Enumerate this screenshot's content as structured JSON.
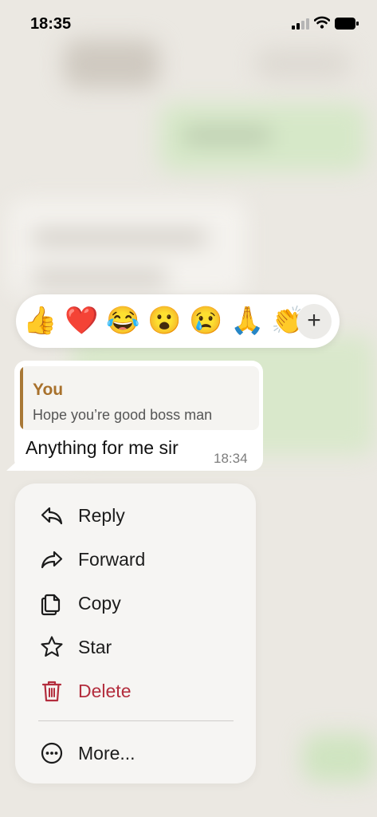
{
  "status_bar": {
    "time": "18:35"
  },
  "reactions": {
    "emojis": [
      "👍",
      "❤️",
      "😂",
      "😮",
      "😢",
      "🙏",
      "👏"
    ],
    "more_label": "+"
  },
  "message": {
    "quoted_author": "You",
    "quoted_text": "Hope you’re good boss man",
    "text": "Anything for me  sir",
    "time": "18:34"
  },
  "menu": {
    "items": [
      {
        "label": "Reply",
        "icon": "reply-icon"
      },
      {
        "label": "Forward",
        "icon": "forward-icon"
      },
      {
        "label": "Copy",
        "icon": "copy-icon"
      },
      {
        "label": "Star",
        "icon": "star-icon"
      },
      {
        "label": "Delete",
        "icon": "trash-icon"
      },
      {
        "label": "More...",
        "icon": "more-icon"
      }
    ]
  },
  "colors": {
    "quote_accent": "#a8712c",
    "delete": "#b32d3d",
    "menu_bg": "#f6f5f3"
  }
}
